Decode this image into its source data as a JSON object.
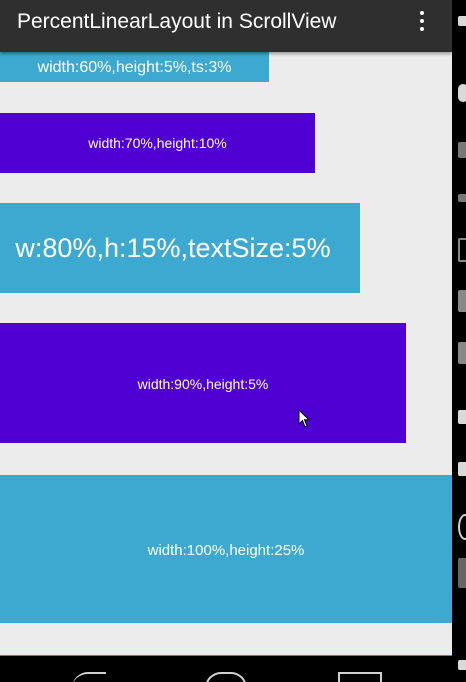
{
  "action_bar": {
    "title": "PercentLinearLayout in ScrollView",
    "overflow_icon": "more-vert-icon"
  },
  "colors": {
    "action_bar": "#2f2f2f",
    "background": "#ececec",
    "light_blue": "#3ea9d0",
    "purple": "#4e01d2"
  },
  "bars": [
    {
      "label": "width:60%,height:5%,ts:3%",
      "color": "light_blue"
    },
    {
      "label": "width:70%,height:10%",
      "color": "purple"
    },
    {
      "label": "w:80%,h:15%,textSize:5%",
      "color": "light_blue"
    },
    {
      "label": "width:90%,height:5%",
      "color": "purple"
    },
    {
      "label": "width:100%,height:25%",
      "color": "light_blue"
    }
  ],
  "navigation": {
    "back_icon": "back-icon",
    "home_icon": "home-icon",
    "recent_icon": "recent-apps-icon"
  }
}
